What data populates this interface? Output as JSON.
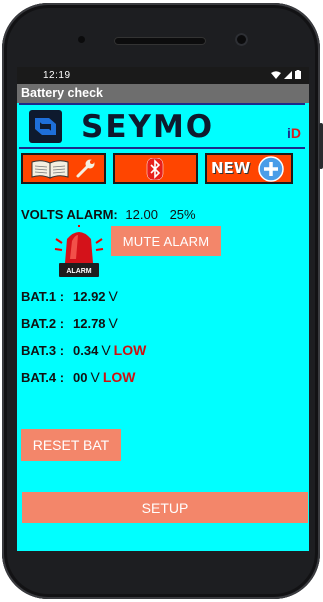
{
  "status_bar": {
    "time": "12:19",
    "icons": [
      "wifi-icon",
      "signal-icon",
      "battery-icon"
    ]
  },
  "app": {
    "title": "Battery check"
  },
  "header": {
    "brand": "SEYMO",
    "badge_i": "i",
    "badge_d": "D"
  },
  "toolbar": {
    "new_label": "NEW"
  },
  "volts": {
    "label": "VOLTS ALARM:",
    "value": "12.00",
    "percent": "25%"
  },
  "alarm": {
    "light_label": "ALARM",
    "mute_label": "MUTE  ALARM"
  },
  "batteries": [
    {
      "name": "BAT.1 :",
      "value": "12.92",
      "unit": "V",
      "status": ""
    },
    {
      "name": "BAT.2 :",
      "value": "12.78",
      "unit": "V",
      "status": ""
    },
    {
      "name": "BAT.3 :",
      "value": "0.34",
      "unit": "V",
      "status": "LOW"
    },
    {
      "name": "BAT.4 :",
      "value": "00",
      "unit": "V",
      "status": "LOW"
    }
  ],
  "buttons": {
    "reset": "RESET BAT",
    "setup": "SETUP"
  },
  "colors": {
    "screen_bg": "#00ffff",
    "toolbar_btn": "#ff4500",
    "action_btn": "#f3866a",
    "low_text": "#d01010",
    "brand_line": "#1c2b8a"
  }
}
